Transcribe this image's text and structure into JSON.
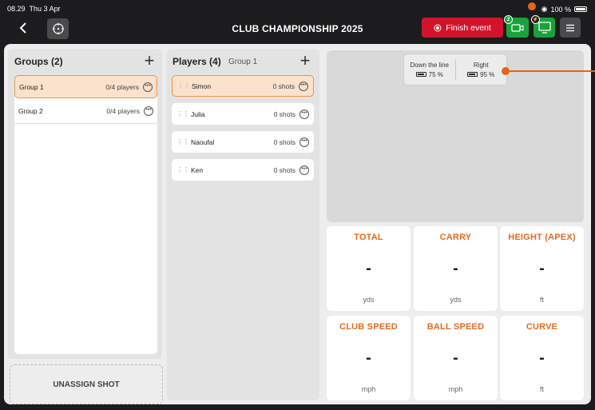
{
  "status": {
    "time": "08.29",
    "date": "Thu 3 Apr",
    "battery": "100 %"
  },
  "header": {
    "title": "CLUB CHAMPIONSHIP 2025",
    "finish_label": "Finish event",
    "camera_badge": "2"
  },
  "groups": {
    "title": "Groups (2)",
    "items": [
      {
        "name": "Group 1",
        "count": "0/4 players"
      },
      {
        "name": "Group 2",
        "count": "0/4 players"
      }
    ]
  },
  "players": {
    "title": "Players (4)",
    "subtitle": "Group 1",
    "items": [
      {
        "name": "Simon",
        "shots": "0 shots"
      },
      {
        "name": "Julia",
        "shots": "0 shots"
      },
      {
        "name": "Naoufal",
        "shots": "0 shots"
      },
      {
        "name": "Ken",
        "shots": "0 shots"
      }
    ]
  },
  "unassign_label": "UNASSIGN SHOT",
  "devices": [
    {
      "name": "Down the line",
      "battery": "75 %"
    },
    {
      "name": "Right",
      "battery": "95 %"
    }
  ],
  "metrics": [
    {
      "label": "TOTAL",
      "value": "-",
      "unit": "yds"
    },
    {
      "label": "CARRY",
      "value": "-",
      "unit": "yds"
    },
    {
      "label": "HEIGHT (APEX)",
      "value": "-",
      "unit": "ft"
    },
    {
      "label": "CLUB SPEED",
      "value": "-",
      "unit": "mph"
    },
    {
      "label": "BALL SPEED",
      "value": "-",
      "unit": "mph"
    },
    {
      "label": "CURVE",
      "value": "-",
      "unit": "ft"
    }
  ],
  "colors": {
    "accent": "#e26b22",
    "finish": "#d1142b",
    "green": "#18a33a"
  }
}
